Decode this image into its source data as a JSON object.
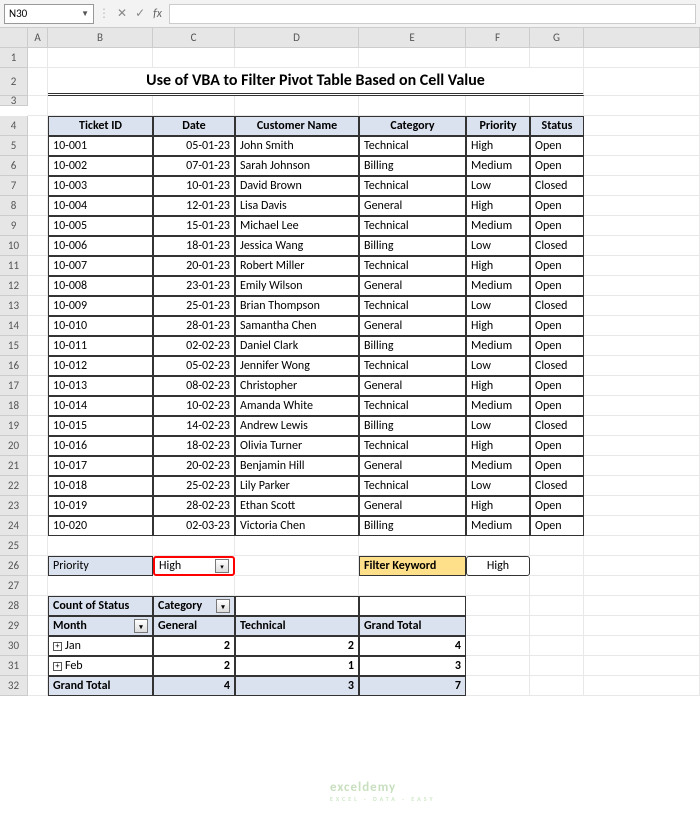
{
  "toolbar": {
    "namebox": "N30",
    "fx": "fx"
  },
  "columns": [
    "A",
    "B",
    "C",
    "D",
    "E",
    "F",
    "G"
  ],
  "title": "Use of VBA to Filter Pivot Table Based on Cell Value",
  "table": {
    "headers": [
      "Ticket ID",
      "Date",
      "Customer Name",
      "Category",
      "Priority",
      "Status"
    ],
    "rows": [
      [
        "10-001",
        "05-01-23",
        "John Smith",
        "Technical",
        "High",
        "Open"
      ],
      [
        "10-002",
        "07-01-23",
        "Sarah Johnson",
        "Billing",
        "Medium",
        "Open"
      ],
      [
        "10-003",
        "10-01-23",
        "David Brown",
        "Technical",
        "Low",
        "Closed"
      ],
      [
        "10-004",
        "12-01-23",
        "Lisa Davis",
        "General",
        "High",
        "Open"
      ],
      [
        "10-005",
        "15-01-23",
        "Michael Lee",
        "Technical",
        "Medium",
        "Open"
      ],
      [
        "10-006",
        "18-01-23",
        "Jessica Wang",
        "Billing",
        "Low",
        "Closed"
      ],
      [
        "10-007",
        "20-01-23",
        "Robert Miller",
        "Technical",
        "High",
        "Open"
      ],
      [
        "10-008",
        "23-01-23",
        "Emily Wilson",
        "General",
        "Medium",
        "Open"
      ],
      [
        "10-009",
        "25-01-23",
        "Brian Thompson",
        "Technical",
        "Low",
        "Closed"
      ],
      [
        "10-010",
        "28-01-23",
        "Samantha Chen",
        "General",
        "High",
        "Open"
      ],
      [
        "10-011",
        "02-02-23",
        "Daniel Clark",
        "Billing",
        "Medium",
        "Open"
      ],
      [
        "10-012",
        "05-02-23",
        "Jennifer Wong",
        "Technical",
        "Low",
        "Closed"
      ],
      [
        "10-013",
        "08-02-23",
        "Christopher",
        "General",
        "High",
        "Open"
      ],
      [
        "10-014",
        "10-02-23",
        "Amanda White",
        "Technical",
        "Medium",
        "Open"
      ],
      [
        "10-015",
        "14-02-23",
        "Andrew Lewis",
        "Billing",
        "Low",
        "Closed"
      ],
      [
        "10-016",
        "18-02-23",
        "Olivia Turner",
        "Technical",
        "High",
        "Open"
      ],
      [
        "10-017",
        "20-02-23",
        "Benjamin Hill",
        "General",
        "Medium",
        "Open"
      ],
      [
        "10-018",
        "25-02-23",
        "Lily Parker",
        "Technical",
        "Low",
        "Closed"
      ],
      [
        "10-019",
        "28-02-23",
        "Ethan Scott",
        "General",
        "High",
        "Open"
      ],
      [
        "10-020",
        "02-03-23",
        "Victoria Chen",
        "Billing",
        "Medium",
        "Open"
      ]
    ]
  },
  "filter": {
    "label": "Priority",
    "value": "High"
  },
  "keyword": {
    "label": "Filter Keyword",
    "value": "High"
  },
  "pivot": {
    "corner": "Count of Status",
    "col_field": "Category",
    "row_field": "Month",
    "cols": [
      "General",
      "Technical"
    ],
    "grand_col": "Grand Total",
    "rows": [
      {
        "label": "Jan",
        "vals": [
          "2",
          "2",
          "4"
        ]
      },
      {
        "label": "Feb",
        "vals": [
          "2",
          "1",
          "3"
        ]
      }
    ],
    "grand_row": {
      "label": "Grand Total",
      "vals": [
        "4",
        "3",
        "7"
      ]
    }
  },
  "watermark": {
    "main": "exceldemy",
    "sub": "EXCEL · DATA · EASY"
  }
}
